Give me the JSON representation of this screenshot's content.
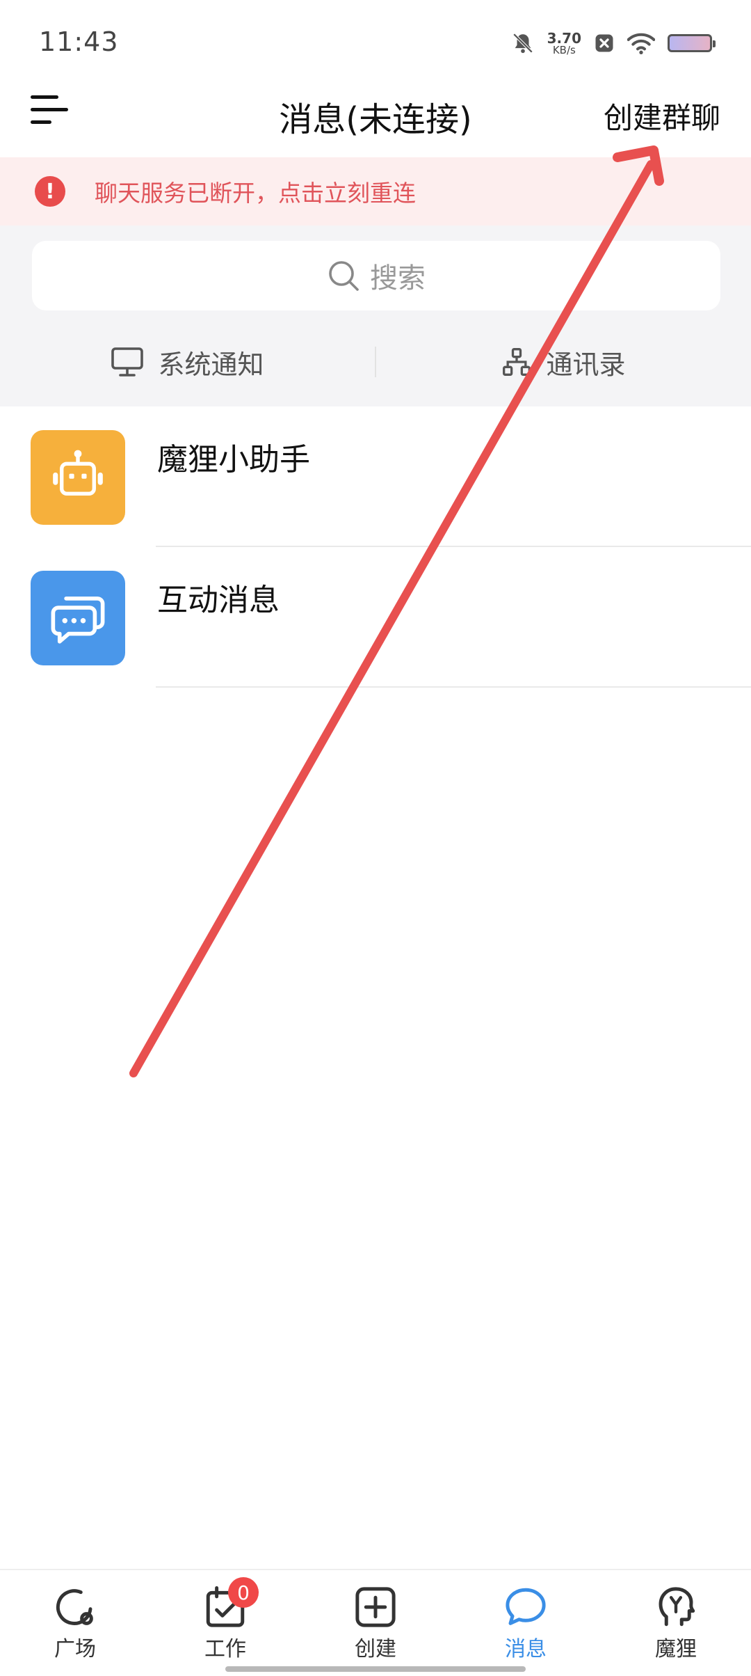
{
  "status_bar": {
    "time": "11:43",
    "net_speed_value": "3.70",
    "net_speed_unit": "KB/s",
    "icons": [
      "bell-off-icon",
      "close-box-icon",
      "wifi-icon",
      "battery-icon"
    ]
  },
  "nav": {
    "title": "消息(未连接)",
    "right_action": "创建群聊",
    "menu_icon": "menu-icon"
  },
  "alert": {
    "text": "聊天服务已断开，点击立刻重连",
    "color": "#e0545a"
  },
  "search": {
    "placeholder": "搜索"
  },
  "quick_tabs": [
    {
      "label": "系统通知",
      "icon": "monitor-icon"
    },
    {
      "label": "通讯录",
      "icon": "org-chart-icon"
    }
  ],
  "conversations": [
    {
      "name": "魔狸小助手",
      "avatar": "robot-icon",
      "avatar_color": "#f6b03c"
    },
    {
      "name": "互动消息",
      "avatar": "chat-bubbles-icon",
      "avatar_color": "#4a97ea"
    }
  ],
  "tab_bar": {
    "items": [
      {
        "label": "广场",
        "icon": "plaza-icon"
      },
      {
        "label": "工作",
        "icon": "calendar-check-icon",
        "badge": "0"
      },
      {
        "label": "创建",
        "icon": "plus-square-icon"
      },
      {
        "label": "消息",
        "icon": "chat-icon",
        "active": true
      },
      {
        "label": "魔狸",
        "icon": "head-icon"
      }
    ]
  },
  "colors": {
    "accent": "#3a8ee6",
    "alert_bg": "#fdeeee",
    "annotation_arrow": "#e8504f"
  }
}
